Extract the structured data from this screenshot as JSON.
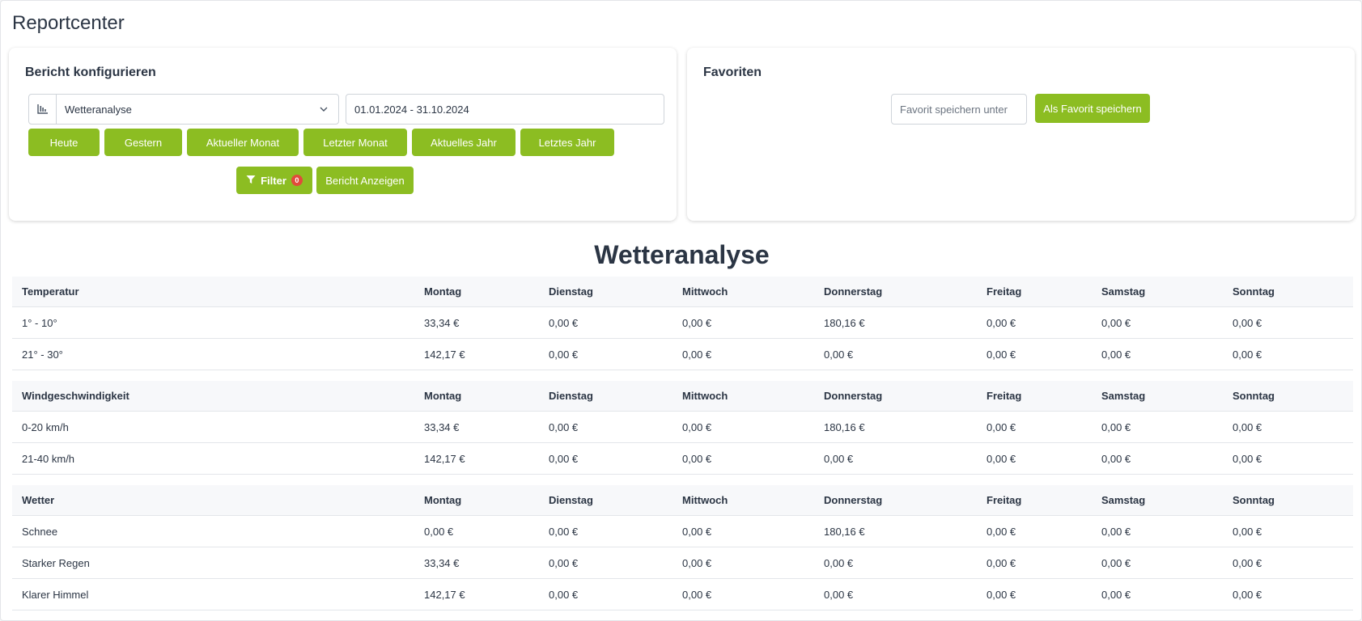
{
  "page": {
    "title": "Reportcenter"
  },
  "config": {
    "title": "Bericht konfigurieren",
    "report_select": {
      "value": "Wetteranalyse",
      "icon": "bar-chart-icon"
    },
    "date_range": "01.01.2024 - 31.10.2024",
    "quick_ranges": [
      "Heute",
      "Gestern",
      "Aktueller Monat",
      "Letzter Monat",
      "Aktuelles Jahr",
      "Letztes Jahr"
    ],
    "filter_label": "Filter",
    "filter_count": "0",
    "show_label": "Bericht Anzeigen"
  },
  "favorites": {
    "title": "Favoriten",
    "input_placeholder": "Favorit speichern unter",
    "save_label": "Als Favorit speichern"
  },
  "report": {
    "title": "Wetteranalyse",
    "days": [
      "Montag",
      "Dienstag",
      "Mittwoch",
      "Donnerstag",
      "Freitag",
      "Samstag",
      "Sonntag"
    ],
    "sections": [
      {
        "heading": "Temperatur",
        "rows": [
          {
            "label": "1° - 10°",
            "values": [
              "33,34 €",
              "0,00 €",
              "0,00 €",
              "180,16 €",
              "0,00 €",
              "0,00 €",
              "0,00 €"
            ]
          },
          {
            "label": "21° - 30°",
            "values": [
              "142,17 €",
              "0,00 €",
              "0,00 €",
              "0,00 €",
              "0,00 €",
              "0,00 €",
              "0,00 €"
            ]
          }
        ]
      },
      {
        "heading": "Windgeschwindigkeit",
        "rows": [
          {
            "label": "0-20 km/h",
            "values": [
              "33,34 €",
              "0,00 €",
              "0,00 €",
              "180,16 €",
              "0,00 €",
              "0,00 €",
              "0,00 €"
            ]
          },
          {
            "label": "21-40 km/h",
            "values": [
              "142,17 €",
              "0,00 €",
              "0,00 €",
              "0,00 €",
              "0,00 €",
              "0,00 €",
              "0,00 €"
            ]
          }
        ]
      },
      {
        "heading": "Wetter",
        "rows": [
          {
            "label": "Schnee",
            "values": [
              "0,00 €",
              "0,00 €",
              "0,00 €",
              "180,16 €",
              "0,00 €",
              "0,00 €",
              "0,00 €"
            ]
          },
          {
            "label": "Starker Regen",
            "values": [
              "33,34 €",
              "0,00 €",
              "0,00 €",
              "0,00 €",
              "0,00 €",
              "0,00 €",
              "0,00 €"
            ]
          },
          {
            "label": "Klarer Himmel",
            "values": [
              "142,17 €",
              "0,00 €",
              "0,00 €",
              "0,00 €",
              "0,00 €",
              "0,00 €",
              "0,00 €"
            ]
          }
        ]
      }
    ]
  },
  "colors": {
    "accent": "#8cbd22",
    "badge": "#e14b3b",
    "text": "#2b3544",
    "header_bg": "#f7f8fa"
  }
}
